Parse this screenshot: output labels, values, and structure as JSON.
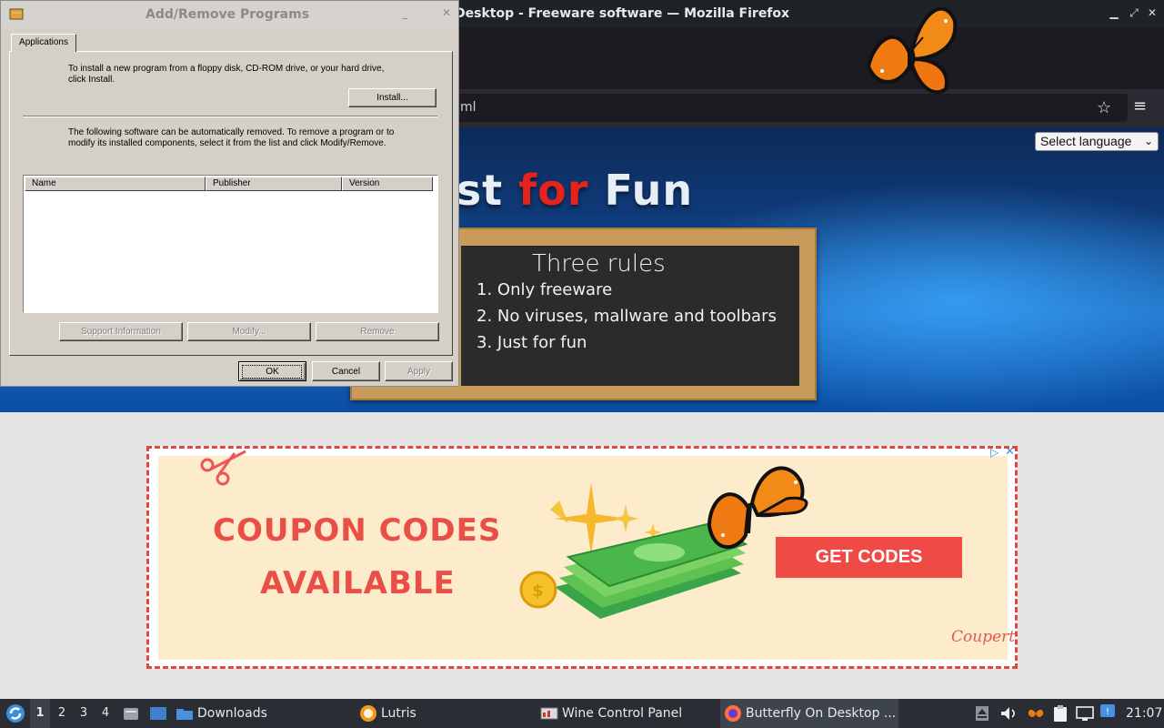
{
  "firefox": {
    "window_title": "Desktop - Freeware software — Mozilla Firefox",
    "url_fragment": "ml",
    "language_select": "Select language",
    "banner": {
      "title_part1": "ust ",
      "title_part2": "for",
      "title_part3": " Fun"
    },
    "chalkboard": {
      "title": "Three rules",
      "rules": [
        "1. Only freeware",
        "2. No viruses, mallware and toolbars",
        "3. Just for fun"
      ]
    },
    "ad": {
      "headline_line1": "COUPON CODES",
      "headline_line2": "AVAILABLE",
      "cta": "GET CODES",
      "logo": "Coupert",
      "adchoices": "▷",
      "close": "✕"
    }
  },
  "wine_dialog": {
    "title": "Add/Remove Programs",
    "tab": "Applications",
    "install_text_line1": "To install a new program from a floppy disk, CD-ROM drive, or your hard drive,",
    "install_text_line2": "click Install.",
    "install_button": "Install...",
    "remove_text_line1": "The following software can be automatically removed. To remove a program or to",
    "remove_text_line2": "modify its installed components, select it from the list and click Modify/Remove.",
    "columns": [
      "Name",
      "Publisher",
      "Version"
    ],
    "support_button": "Support Information",
    "modify_button": "Modify...",
    "remove_button": "Remove",
    "ok_button": "OK",
    "cancel_button": "Cancel",
    "apply_button": "Apply"
  },
  "taskbar": {
    "workspaces": [
      "1",
      "2",
      "3",
      "4"
    ],
    "tasks": [
      {
        "label": "Downloads"
      },
      {
        "label": "Lutris"
      },
      {
        "label": "Wine Control Panel"
      },
      {
        "label": "Butterfly On Desktop ..."
      }
    ],
    "clock": "21:07"
  },
  "colors": {
    "banner_red": "#e4231c",
    "ad_red": "#ea4f47",
    "taskbar_bg": "#2a2e34",
    "wine_face": "#d4d0c8"
  }
}
